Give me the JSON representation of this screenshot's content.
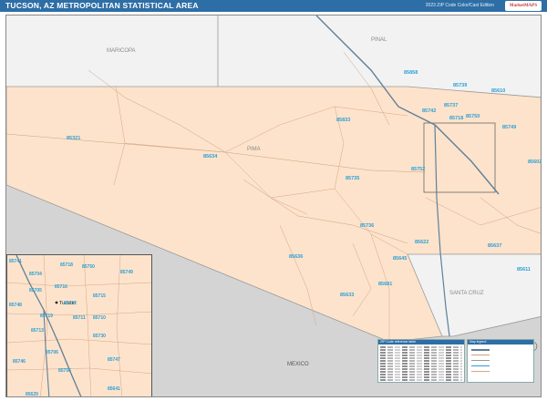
{
  "header": {
    "title": "TUCSON, AZ METROPOLITAN STATISTICAL AREA",
    "edition": "2023 ZIP Code Color/Cast Edition",
    "logo_text": "MarketMAPS"
  },
  "colors": {
    "header_bg": "#2e6ea6",
    "msa_fill": "#fde3cb",
    "outside_fill": "#f2f2f2",
    "mexico_fill": "#d4d4d4",
    "zip_label": "#2a9fd6",
    "highway": "#5f7f98",
    "boundary": "#9a9a9a"
  },
  "regions": {
    "maricopa": "MARICOPA",
    "pinal": "PINAL",
    "pima": "PIMA",
    "santa_cruz": "SANTA CRUZ",
    "mexico": "MEXICO"
  },
  "zip_labels": [
    "85858",
    "85739",
    "85610",
    "85742",
    "85737",
    "85718",
    "85750",
    "85833",
    "85749",
    "85321",
    "85634",
    "85735",
    "85752",
    "85602",
    "85736",
    "85622",
    "85637",
    "85636",
    "85645",
    "85611",
    "85681",
    "85633"
  ],
  "inset": {
    "city": "Tucson",
    "zips": [
      "85741",
      "85704",
      "85718",
      "85750",
      "85749",
      "85705",
      "85716",
      "85712",
      "85715",
      "85711",
      "85719",
      "85710",
      "85748",
      "85730",
      "85713",
      "85706",
      "85746",
      "85747",
      "85756",
      "85641",
      "85629"
    ]
  },
  "legend": {
    "title": "ZIP Code reference table"
  },
  "key": {
    "title": "Map legend"
  }
}
